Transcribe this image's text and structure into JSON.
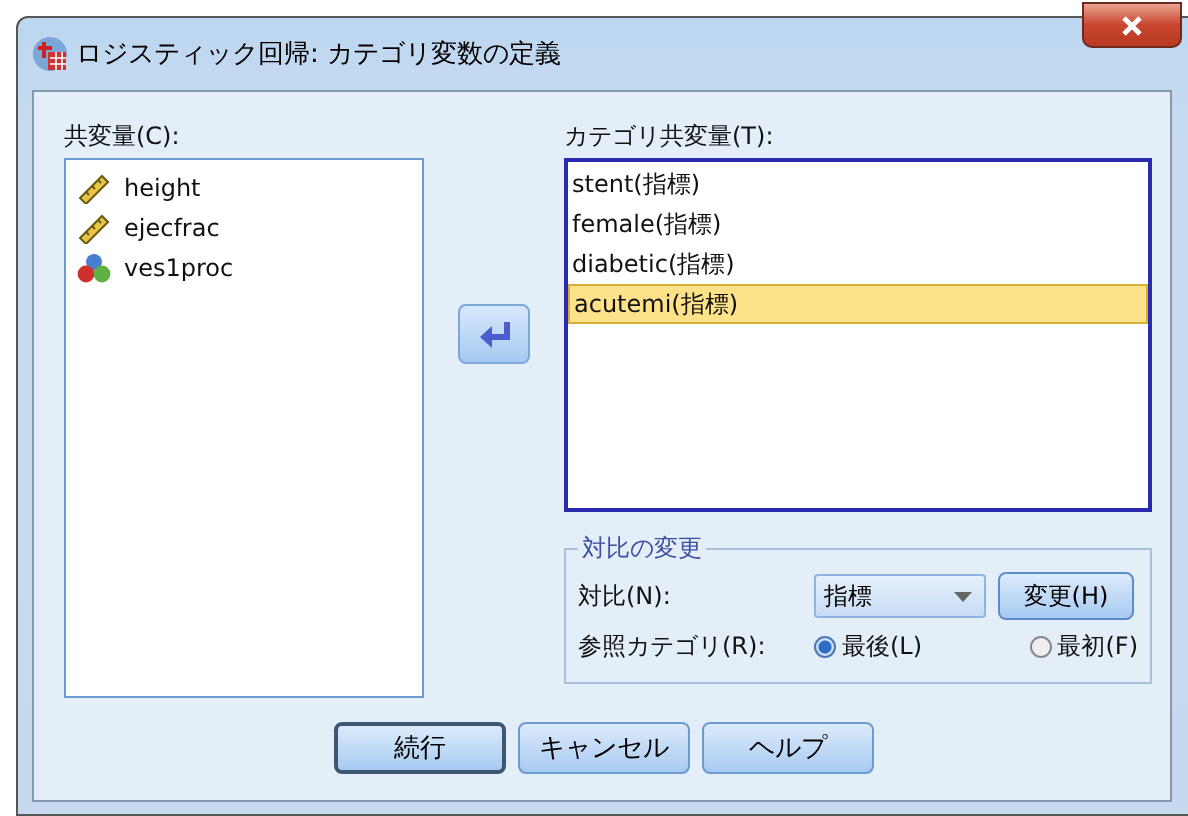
{
  "window": {
    "title": "ロジスティック回帰: カテゴリ変数の定義"
  },
  "covariates": {
    "label": "共変量(C):",
    "items": [
      {
        "name": "height",
        "kind": "scale"
      },
      {
        "name": "ejecfrac",
        "kind": "scale"
      },
      {
        "name": "ves1proc",
        "kind": "nominal"
      }
    ]
  },
  "categorical": {
    "label": "カテゴリ共変量(T):",
    "items": [
      {
        "name": "stent(指標)",
        "selected": false
      },
      {
        "name": "female(指標)",
        "selected": false
      },
      {
        "name": "diabetic(指標)",
        "selected": false
      },
      {
        "name": "acutemi(指標)",
        "selected": true
      }
    ]
  },
  "change_contrast": {
    "title": "対比の変更",
    "contrast_label": "対比(N):",
    "contrast_value": "指標",
    "change_button": "変更(H)",
    "reference_label": "参照カテゴリ(R):",
    "options": [
      {
        "label": "最後(L)",
        "selected": true
      },
      {
        "label": "最初(F)",
        "selected": false
      }
    ]
  },
  "buttons": [
    {
      "label": "続行",
      "default": true
    },
    {
      "label": "キャンセル",
      "default": false
    },
    {
      "label": "ヘルプ",
      "default": false
    }
  ]
}
